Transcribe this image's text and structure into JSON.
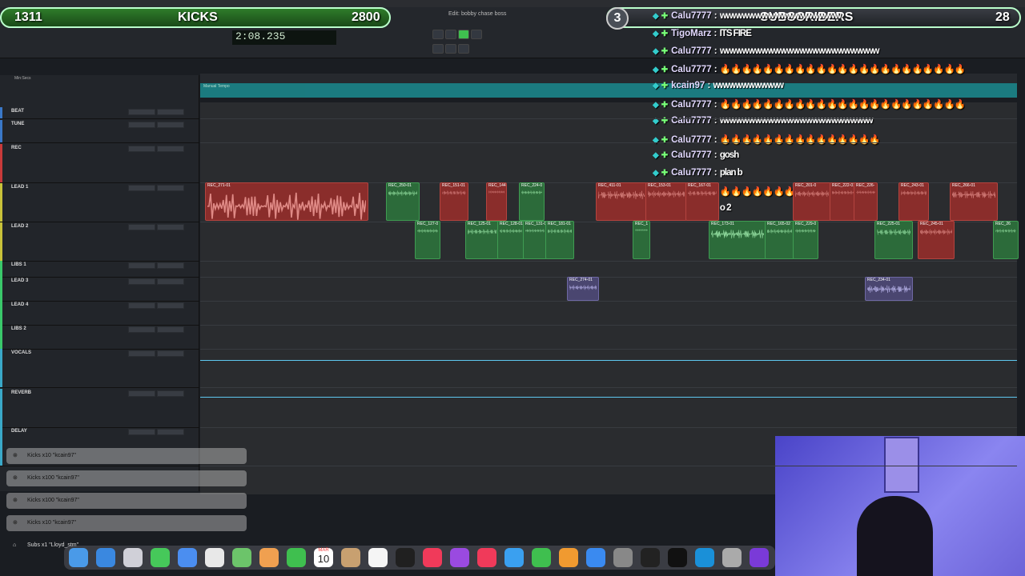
{
  "overlay": {
    "kicks_count": "1311",
    "kicks_label": "KICKS",
    "kicks_goal": "2800",
    "subs_count": "3",
    "subs_label": "SUBSCRIBERS",
    "subs_goal": "28"
  },
  "daw": {
    "window_title": "Edit: bobby chase boss",
    "counter": "2:08.235",
    "ruler_label": "Min:Secs",
    "marker_label": "Manual Tempo",
    "tracks": [
      {
        "name": "BEAT",
        "color": "#3a78c8"
      },
      {
        "name": "TUNE",
        "color": "#3a78c8"
      },
      {
        "name": "REC",
        "color": "#c83a3a"
      },
      {
        "name": "LEAD 1",
        "color": "#c8c23a"
      },
      {
        "name": "LEAD 2",
        "color": "#c8c23a"
      },
      {
        "name": "LIBS 1",
        "color": "#3ac86a"
      },
      {
        "name": "LEAD 3",
        "color": "#3ac86a"
      },
      {
        "name": "LEAD 4",
        "color": "#3ac86a"
      },
      {
        "name": "LIBS 2",
        "color": "#3ac86a"
      },
      {
        "name": "VOCALS",
        "color": "#3aa8c8"
      },
      {
        "name": "REVERB",
        "color": "#3aa8c8"
      },
      {
        "name": "DELAY",
        "color": "#3aa8c8"
      }
    ],
    "clips": [
      {
        "label": "REC_271-01",
        "color": "red"
      },
      {
        "label": "REC_250-01",
        "color": "green"
      },
      {
        "label": "REC_151-01",
        "color": "red"
      },
      {
        "label": "REC_144",
        "color": "red"
      },
      {
        "label": "REC_224-0",
        "color": "green"
      },
      {
        "label": "REC_411-01",
        "color": "red"
      },
      {
        "label": "REC_153-01",
        "color": "red"
      },
      {
        "label": "REC_167-01",
        "color": "red"
      },
      {
        "label": "REC_201-0",
        "color": "red"
      },
      {
        "label": "REC_222-01",
        "color": "red"
      },
      {
        "label": "REC_226-",
        "color": "red"
      },
      {
        "label": "REC_243-01",
        "color": "red"
      },
      {
        "label": "REC_266-01",
        "color": "red"
      },
      {
        "label": "REC_127-0",
        "color": "green"
      },
      {
        "label": "REC_125-01",
        "color": "green"
      },
      {
        "label": "REC_128-01",
        "color": "green"
      },
      {
        "label": "REC_131-01",
        "color": "green"
      },
      {
        "label": "REC_181-01",
        "color": "green"
      },
      {
        "label": "REC_1",
        "color": "green"
      },
      {
        "label": "REC_173-01",
        "color": "green"
      },
      {
        "label": "REC_165-02",
        "color": "green"
      },
      {
        "label": "REC_229-0",
        "color": "green"
      },
      {
        "label": "REC_225-01",
        "color": "green"
      },
      {
        "label": "REC_245-01",
        "color": "red"
      },
      {
        "label": "REC_26",
        "color": "green"
      },
      {
        "label": "REC_274-01",
        "color": "purple"
      },
      {
        "label": "REC_234-01",
        "color": "purple"
      }
    ]
  },
  "chat": [
    {
      "user": "Calu7777",
      "msg": "wwwwwwwwwwwwwwwwwww"
    },
    {
      "user": "TigoMarz",
      "msg": "ITS FIRE"
    },
    {
      "user": "Calu7777",
      "msg": "wwwwwwwwwwwwwwwwwwwwwwwww"
    },
    {
      "user": "Calu7777",
      "msg": "🔥🔥🔥🔥🔥🔥🔥🔥🔥🔥🔥🔥🔥🔥🔥🔥🔥🔥🔥🔥🔥🔥🔥"
    },
    {
      "user": "kcain97",
      "msg": "wwwwwwwwwww"
    },
    {
      "user": "Calu7777",
      "msg": "🔥🔥🔥🔥🔥🔥🔥🔥🔥🔥🔥🔥🔥🔥🔥🔥🔥🔥🔥🔥🔥🔥🔥"
    },
    {
      "user": "Calu7777",
      "msg": "wwwwwwwwwwwwwwwwwwwwwwww"
    },
    {
      "user": "Calu7777",
      "msg": "🔥🔥🔥🔥🔥🔥🔥🔥🔥🔥🔥🔥🔥🔥🔥"
    },
    {
      "user": "Calu7777",
      "msg": "gosh"
    },
    {
      "user": "Calu7777",
      "msg": "plan b"
    },
    {
      "user": "Calu7777",
      "msg": "🔥🔥🔥🔥🔥🔥🔥🔥🔥🔥🔥🔥🔥"
    },
    {
      "user": "Calu7777",
      "msg": "o 2"
    }
  ],
  "alerts": [
    {
      "text": "Kicks x10 \"kcain97\""
    },
    {
      "text": "Kicks x100 \"kcain97\""
    },
    {
      "text": "Kicks x100 \"kcain97\""
    },
    {
      "text": "Kicks x10 \"kcain97\""
    },
    {
      "text": "Subs x1 \"Lloyd_stm\""
    }
  ],
  "dock": {
    "calendar_month": "MAR",
    "calendar_day": "10"
  }
}
